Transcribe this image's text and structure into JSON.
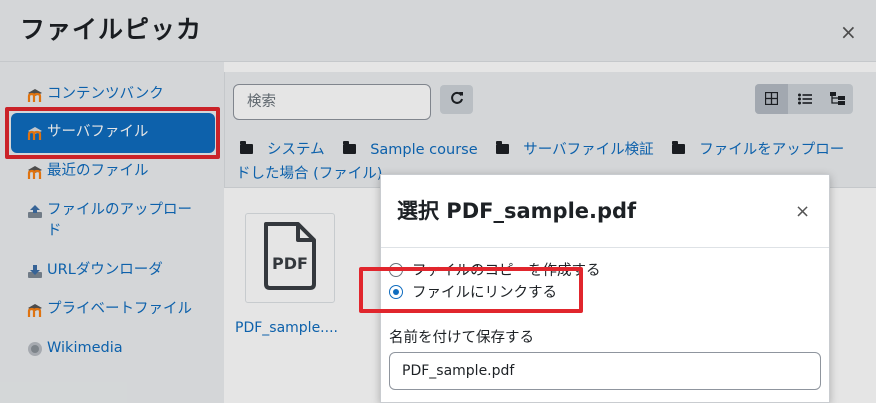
{
  "picker": {
    "title": "ファイルピッカ",
    "close_label": "×"
  },
  "sidebar": {
    "items": [
      {
        "label": "コンテンツバンク",
        "icon": "moodle-icon"
      },
      {
        "label": "サーバファイル",
        "icon": "moodle-icon",
        "active": true
      },
      {
        "label": "最近のファイル",
        "icon": "moodle-icon"
      },
      {
        "label": "ファイルのアップロード",
        "icon": "upload-icon"
      },
      {
        "label": "URLダウンローダ",
        "icon": "download-icon"
      },
      {
        "label": "プライベートファイル",
        "icon": "moodle-icon"
      },
      {
        "label": "Wikimedia",
        "icon": "wikimedia-icon"
      }
    ]
  },
  "toolbar": {
    "search_placeholder": "検索",
    "refresh_icon": "refresh-icon",
    "view_icons": [
      "grid-view-icon",
      "list-view-icon",
      "tree-view-icon"
    ]
  },
  "path": {
    "crumbs": [
      "システム",
      "Sample course",
      "サーバファイル検証",
      "ファイルをアップロードした場合 (ファイル)"
    ]
  },
  "files": [
    {
      "name": "PDF_sample....",
      "icon": "pdf-file-icon",
      "badge": "PDF"
    }
  ],
  "dialog": {
    "title": "選択 PDF_sample.pdf",
    "close_label": "×",
    "options": [
      {
        "label": "ファイルのコピーを作成する",
        "selected": false
      },
      {
        "label": "ファイルにリンクする",
        "selected": true
      }
    ],
    "save_as_label": "名前を付けて保存する",
    "save_as_value": "PDF_sample.pdf"
  },
  "colors": {
    "accent": "#0f6cbf",
    "highlight": "#e1262d",
    "panel_bg": "#eceff1"
  }
}
